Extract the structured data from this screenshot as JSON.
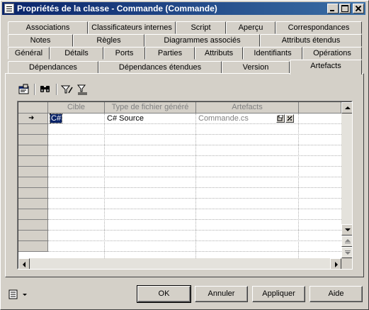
{
  "window": {
    "title": "Propriétés de la classe - Commande (Commande)"
  },
  "tabs": {
    "row1": [
      "Associations",
      "Classificateurs internes",
      "Script",
      "Aperçu",
      "Correspondances"
    ],
    "row2": [
      "Notes",
      "Règles",
      "Diagrammes associés",
      "Attributs étendus"
    ],
    "row3": [
      "Général",
      "Détails",
      "Ports",
      "Parties",
      "Attributs",
      "Identifiants",
      "Opérations"
    ],
    "row4": [
      "Dépendances",
      "Dépendances étendues",
      "Version",
      "Artefacts"
    ],
    "active": "Artefacts"
  },
  "toolbar": {
    "icons": [
      "properties-icon",
      "find-icon",
      "filter-icon",
      "clear-filter-icon"
    ]
  },
  "grid": {
    "columns": [
      "Cible",
      "Type de fichier généré",
      "Artefacts"
    ],
    "rows": [
      {
        "cible": "C#",
        "type": "C# Source",
        "artefact": "Commande.cs"
      }
    ]
  },
  "buttons": {
    "ok": "OK",
    "cancel": "Annuler",
    "apply": "Appliquer",
    "help": "Aide"
  }
}
